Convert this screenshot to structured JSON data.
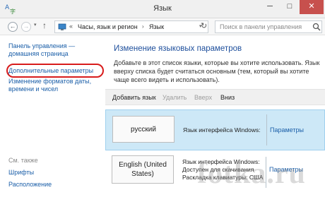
{
  "window": {
    "title": "Язык",
    "minimize": "─",
    "maximize": "□",
    "close": "✕"
  },
  "nav": {
    "back": "←",
    "forward": "→",
    "recent": "▾",
    "up": "↑",
    "address_chevron": "«",
    "breadcrumbs": [
      "Часы, язык и регион",
      "Язык"
    ],
    "breadcrumb_separator": "›",
    "address_dropdown": "▾",
    "refresh": "↻",
    "search_placeholder": "Поиск в панели управления"
  },
  "sidebar": {
    "home": "Панель управления — домашняя страница",
    "advanced": "Дополнительные параметры",
    "formats": "Изменение форматов даты, времени и чисел",
    "see_also": "См. также",
    "fonts": "Шрифты",
    "location": "Расположение"
  },
  "main": {
    "title": "Изменение языковых параметров",
    "description": "Добавьте в этот список языки, которые вы хотите использовать. Язык вверху списка будет считаться основным (тем, который вы хотите чаще всего видеть и использовать)."
  },
  "toolbar": {
    "add": "Добавить язык",
    "delete": "Удалить",
    "up": "Вверх",
    "down": "Вниз"
  },
  "languages": [
    {
      "name": "русский",
      "info": "Язык интерфейса Windows:",
      "options": "Параметры"
    },
    {
      "name": "English (United States)",
      "info": "Язык интерфейса Windows: Доступен для скачивания Раскладка клавиатуры: США",
      "options": "Параметры"
    }
  ],
  "watermark": "fotka.ru",
  "colors": {
    "link": "#1a5ea8",
    "title": "#1e4f9c",
    "selected_row": "#cde8f7",
    "close_button": "#c7504d",
    "highlight_ring": "#d81c1c"
  }
}
